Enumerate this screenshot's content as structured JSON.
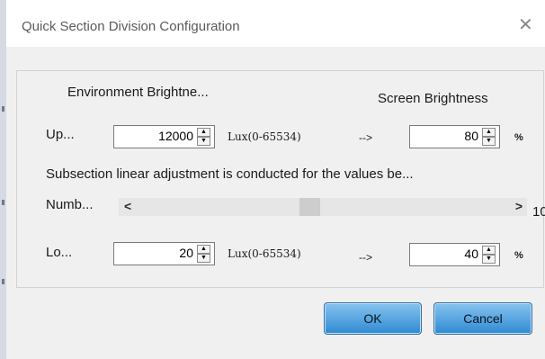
{
  "dialog": {
    "title": "Quick Section Division Configuration",
    "close_glyph": "✕",
    "env_header": "Environment Brightne...",
    "screen_header": "Screen Brightness",
    "upper": {
      "label": "Up...",
      "lux_value": "12000",
      "lux_unit": "Lux(0-65534)",
      "arrow": "-->",
      "screen_value": "80",
      "screen_unit": "%"
    },
    "note": "Subsection linear adjustment is conducted for the values be...",
    "number": {
      "label": "Numb...",
      "left_arrow": "<",
      "right_arrow": ">",
      "value": "10"
    },
    "lower": {
      "label": "Lo...",
      "lux_value": "20",
      "lux_unit": "Lux(0-65534)",
      "arrow": "-->",
      "screen_value": "40",
      "screen_unit": "%"
    },
    "ok_label": "OK",
    "cancel_label": "Cancel"
  },
  "icons": {
    "close": "close-icon",
    "spin_up": "spin-up-icon",
    "spin_down": "spin-down-icon",
    "scroll_left": "scroll-left-icon",
    "scroll_right": "scroll-right-icon"
  },
  "colors": {
    "button_top": "#86c3ef",
    "button_bottom": "#2f8ad1",
    "dialog_bg": "#f0f0f0"
  }
}
